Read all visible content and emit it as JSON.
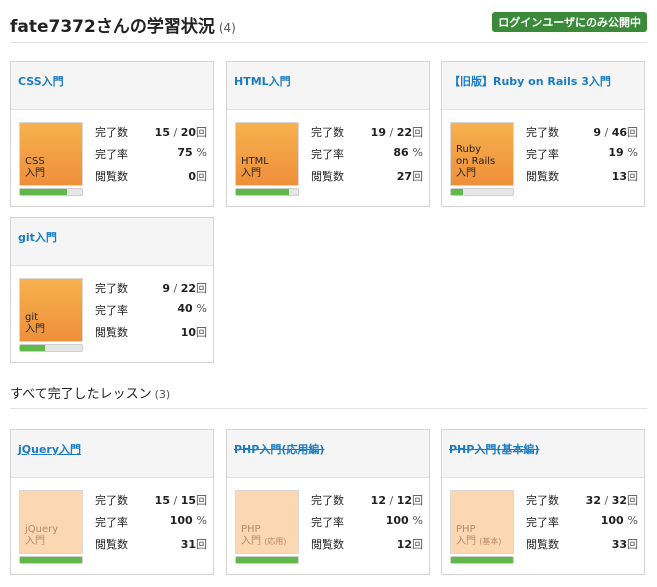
{
  "header": {
    "title": "fate7372さんの学習状況",
    "count": "(4)",
    "badge": "ログインユーザにのみ公開中"
  },
  "in_progress": [
    {
      "title": "CSS入門",
      "thumb": "CSS\n入門",
      "thumb_sub": "",
      "progress": 0.75,
      "completed": "15",
      "total": "20",
      "rate": "75",
      "views": "0"
    },
    {
      "title": "HTML入門",
      "thumb": "HTML\n入門",
      "thumb_sub": "",
      "progress": 0.86,
      "completed": "19",
      "total": "22",
      "rate": "86",
      "views": "27"
    },
    {
      "title": "【旧版】Ruby on Rails 3入門",
      "thumb": "Ruby\non Rails\n入門",
      "thumb_sub": "",
      "progress": 0.19,
      "completed": "9",
      "total": "46",
      "rate": "19",
      "views": "13"
    },
    {
      "title": "git入門",
      "thumb": "git\n入門",
      "thumb_sub": "",
      "progress": 0.4,
      "completed": "9",
      "total": "22",
      "rate": "40",
      "views": "10"
    }
  ],
  "labels": {
    "completed": "完了数",
    "rate": "完了率",
    "views": "閲覧数",
    "times_unit": "回",
    "percent_unit": "%",
    "slash": " / "
  },
  "completed_section": {
    "title": "すべて完了したレッスン",
    "count": "(3)"
  },
  "completed_lessons": [
    {
      "title": "jQuery入門",
      "thumb": "jQuery\n入門",
      "thumb_sub": "",
      "progress": 1.0,
      "completed": "15",
      "total": "15",
      "rate": "100",
      "views": "31"
    },
    {
      "title": "PHP入門(応用編)",
      "thumb": "PHP\n入門",
      "thumb_sub": "(応用)",
      "progress": 1.0,
      "completed": "12",
      "total": "12",
      "rate": "100",
      "views": "12"
    },
    {
      "title": "PHP入門(基本編)",
      "thumb": "PHP\n入門",
      "thumb_sub": "(基本)",
      "progress": 1.0,
      "completed": "32",
      "total": "32",
      "rate": "100",
      "views": "33"
    }
  ],
  "colors": {
    "link": "#1a7cc4",
    "badge": "#3a8a3a",
    "progress": "#5fb848",
    "thumb_active": "#f6a04a",
    "thumb_done": "#fbd7b2"
  }
}
